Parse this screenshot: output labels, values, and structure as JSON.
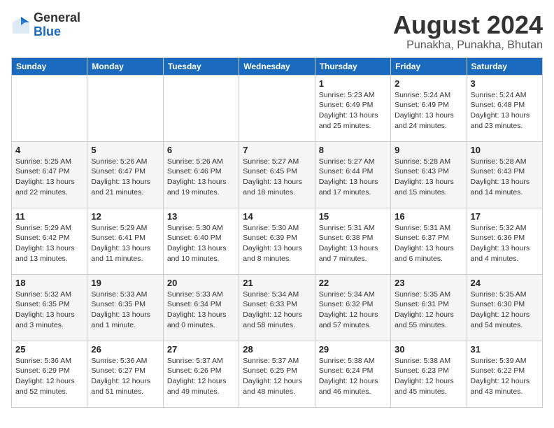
{
  "header": {
    "logo": {
      "general": "General",
      "blue": "Blue"
    },
    "title": "August 2024",
    "location": "Punakha, Punakha, Bhutan"
  },
  "weekdays": [
    "Sunday",
    "Monday",
    "Tuesday",
    "Wednesday",
    "Thursday",
    "Friday",
    "Saturday"
  ],
  "weeks": [
    [
      {
        "day": "",
        "info": ""
      },
      {
        "day": "",
        "info": ""
      },
      {
        "day": "",
        "info": ""
      },
      {
        "day": "",
        "info": ""
      },
      {
        "day": "1",
        "info": "Sunrise: 5:23 AM\nSunset: 6:49 PM\nDaylight: 13 hours\nand 25 minutes."
      },
      {
        "day": "2",
        "info": "Sunrise: 5:24 AM\nSunset: 6:49 PM\nDaylight: 13 hours\nand 24 minutes."
      },
      {
        "day": "3",
        "info": "Sunrise: 5:24 AM\nSunset: 6:48 PM\nDaylight: 13 hours\nand 23 minutes."
      }
    ],
    [
      {
        "day": "4",
        "info": "Sunrise: 5:25 AM\nSunset: 6:47 PM\nDaylight: 13 hours\nand 22 minutes."
      },
      {
        "day": "5",
        "info": "Sunrise: 5:26 AM\nSunset: 6:47 PM\nDaylight: 13 hours\nand 21 minutes."
      },
      {
        "day": "6",
        "info": "Sunrise: 5:26 AM\nSunset: 6:46 PM\nDaylight: 13 hours\nand 19 minutes."
      },
      {
        "day": "7",
        "info": "Sunrise: 5:27 AM\nSunset: 6:45 PM\nDaylight: 13 hours\nand 18 minutes."
      },
      {
        "day": "8",
        "info": "Sunrise: 5:27 AM\nSunset: 6:44 PM\nDaylight: 13 hours\nand 17 minutes."
      },
      {
        "day": "9",
        "info": "Sunrise: 5:28 AM\nSunset: 6:43 PM\nDaylight: 13 hours\nand 15 minutes."
      },
      {
        "day": "10",
        "info": "Sunrise: 5:28 AM\nSunset: 6:43 PM\nDaylight: 13 hours\nand 14 minutes."
      }
    ],
    [
      {
        "day": "11",
        "info": "Sunrise: 5:29 AM\nSunset: 6:42 PM\nDaylight: 13 hours\nand 13 minutes."
      },
      {
        "day": "12",
        "info": "Sunrise: 5:29 AM\nSunset: 6:41 PM\nDaylight: 13 hours\nand 11 minutes."
      },
      {
        "day": "13",
        "info": "Sunrise: 5:30 AM\nSunset: 6:40 PM\nDaylight: 13 hours\nand 10 minutes."
      },
      {
        "day": "14",
        "info": "Sunrise: 5:30 AM\nSunset: 6:39 PM\nDaylight: 13 hours\nand 8 minutes."
      },
      {
        "day": "15",
        "info": "Sunrise: 5:31 AM\nSunset: 6:38 PM\nDaylight: 13 hours\nand 7 minutes."
      },
      {
        "day": "16",
        "info": "Sunrise: 5:31 AM\nSunset: 6:37 PM\nDaylight: 13 hours\nand 6 minutes."
      },
      {
        "day": "17",
        "info": "Sunrise: 5:32 AM\nSunset: 6:36 PM\nDaylight: 13 hours\nand 4 minutes."
      }
    ],
    [
      {
        "day": "18",
        "info": "Sunrise: 5:32 AM\nSunset: 6:35 PM\nDaylight: 13 hours\nand 3 minutes."
      },
      {
        "day": "19",
        "info": "Sunrise: 5:33 AM\nSunset: 6:35 PM\nDaylight: 13 hours\nand 1 minute."
      },
      {
        "day": "20",
        "info": "Sunrise: 5:33 AM\nSunset: 6:34 PM\nDaylight: 13 hours\nand 0 minutes."
      },
      {
        "day": "21",
        "info": "Sunrise: 5:34 AM\nSunset: 6:33 PM\nDaylight: 12 hours\nand 58 minutes."
      },
      {
        "day": "22",
        "info": "Sunrise: 5:34 AM\nSunset: 6:32 PM\nDaylight: 12 hours\nand 57 minutes."
      },
      {
        "day": "23",
        "info": "Sunrise: 5:35 AM\nSunset: 6:31 PM\nDaylight: 12 hours\nand 55 minutes."
      },
      {
        "day": "24",
        "info": "Sunrise: 5:35 AM\nSunset: 6:30 PM\nDaylight: 12 hours\nand 54 minutes."
      }
    ],
    [
      {
        "day": "25",
        "info": "Sunrise: 5:36 AM\nSunset: 6:29 PM\nDaylight: 12 hours\nand 52 minutes."
      },
      {
        "day": "26",
        "info": "Sunrise: 5:36 AM\nSunset: 6:27 PM\nDaylight: 12 hours\nand 51 minutes."
      },
      {
        "day": "27",
        "info": "Sunrise: 5:37 AM\nSunset: 6:26 PM\nDaylight: 12 hours\nand 49 minutes."
      },
      {
        "day": "28",
        "info": "Sunrise: 5:37 AM\nSunset: 6:25 PM\nDaylight: 12 hours\nand 48 minutes."
      },
      {
        "day": "29",
        "info": "Sunrise: 5:38 AM\nSunset: 6:24 PM\nDaylight: 12 hours\nand 46 minutes."
      },
      {
        "day": "30",
        "info": "Sunrise: 5:38 AM\nSunset: 6:23 PM\nDaylight: 12 hours\nand 45 minutes."
      },
      {
        "day": "31",
        "info": "Sunrise: 5:39 AM\nSunset: 6:22 PM\nDaylight: 12 hours\nand 43 minutes."
      }
    ]
  ]
}
